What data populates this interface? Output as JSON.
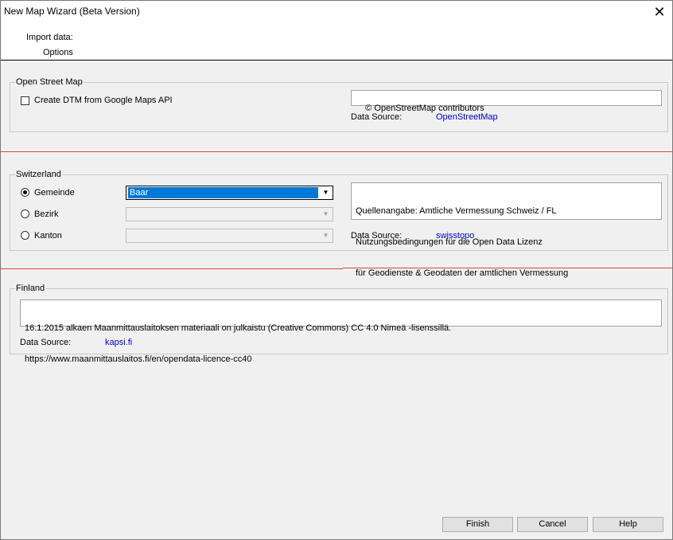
{
  "window": {
    "title": "New Map Wizard (Beta Version)",
    "close_glyph": "✕"
  },
  "header": {
    "step1": "Import data:",
    "step2": "Options"
  },
  "osm": {
    "legend": "Open Street Map",
    "checkbox_label": "Create DTM from Google Maps API",
    "checked": false,
    "attribution": "© OpenStreetMap contributors",
    "source_label": "Data Source:",
    "source_link": "OpenStreetMap"
  },
  "switzerland": {
    "legend": "Switzerland",
    "options": [
      {
        "label": "Gemeinde",
        "checked": true,
        "value": "Baar"
      },
      {
        "label": "Bezirk",
        "checked": false,
        "value": ""
      },
      {
        "label": "Kanton",
        "checked": false,
        "value": ""
      }
    ],
    "attribution_lines": [
      "Quellenangabe: Amtliche Vermessung Schweiz / FL",
      "Nutzungsbedingungen für die Open Data Lizenz",
      "für Geodienste & Geodaten der amtlichen Vermessung"
    ],
    "source_label": "Data Source:",
    "source_link": "swisstopo"
  },
  "finland": {
    "legend": "Finland",
    "attribution_lines": [
      "16.1.2015 alkaen Maanmittauslaitoksen materiaali on julkaistu (Creative Commons) CC 4.0 Nimeä -lisenssillä.",
      "https://www.maanmittauslaitos.fi/en/opendata-licence-cc40"
    ],
    "source_label": "Data Source:",
    "source_link": "kapsi.fi"
  },
  "buttons": {
    "finish": "Finish",
    "cancel": "Cancel",
    "help": "Help"
  },
  "colors": {
    "divider": "#dd4444",
    "link": "#0000cc",
    "selection": "#0078d7"
  }
}
